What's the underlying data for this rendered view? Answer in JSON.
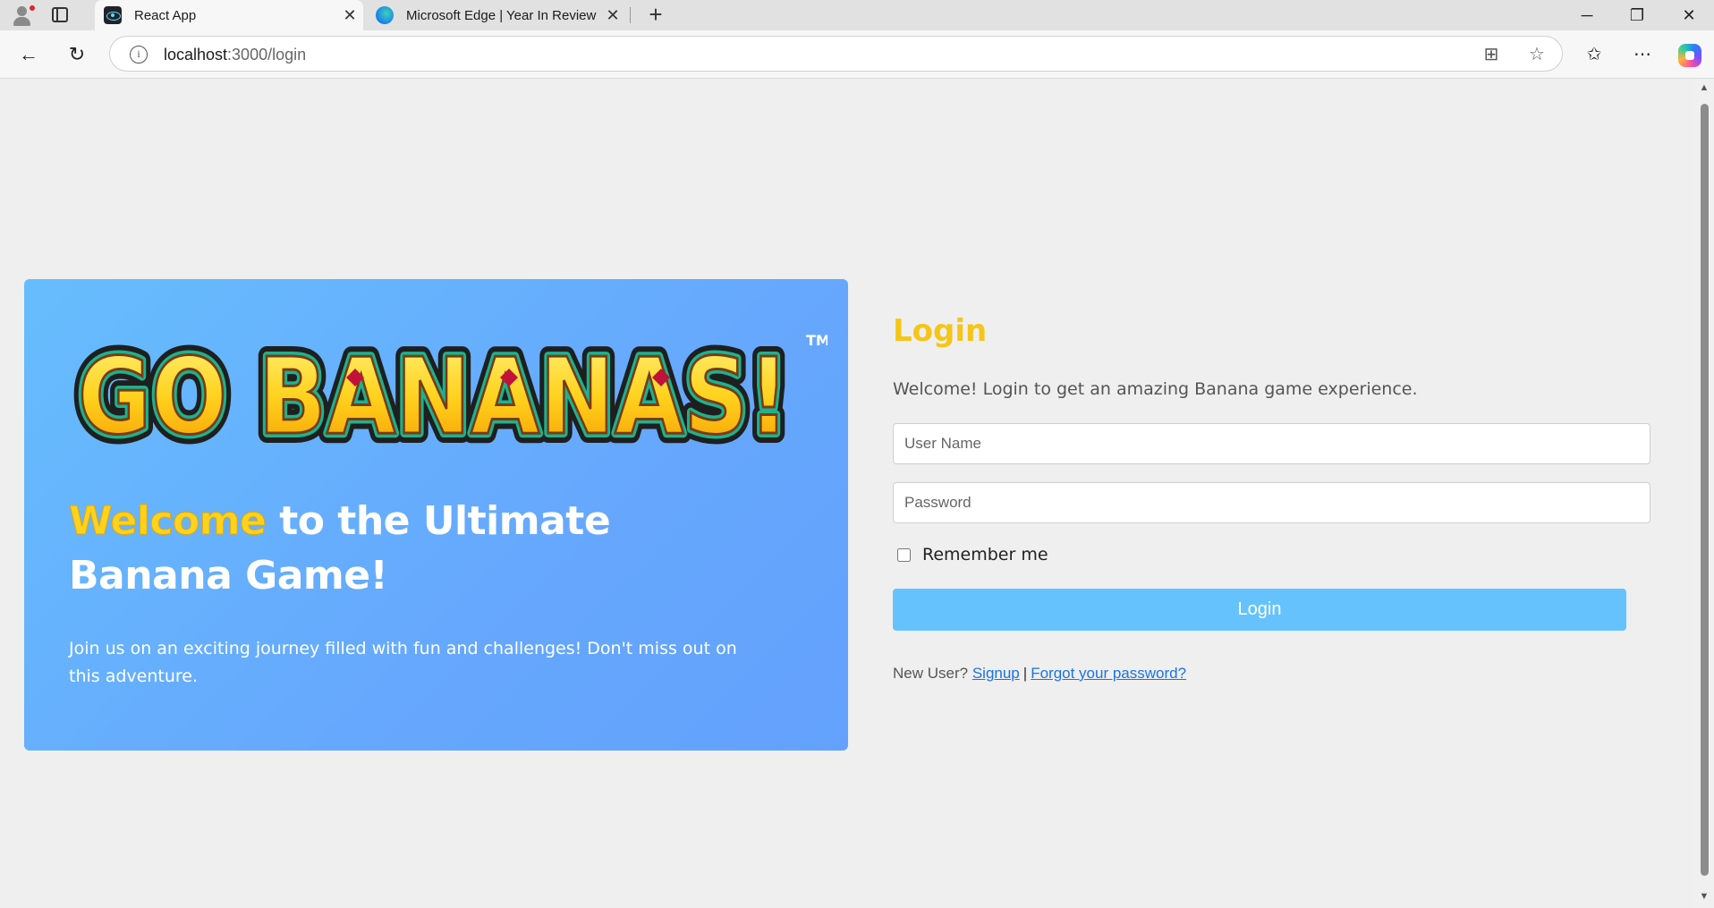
{
  "browser": {
    "tabs": [
      {
        "title": "React App",
        "icon": "react-icon",
        "active": true
      },
      {
        "title": "Microsoft Edge | Year In Review",
        "icon": "edge-icon",
        "active": false
      }
    ],
    "address": {
      "host": "localhost",
      "path": ":3000/login"
    }
  },
  "hero": {
    "logo_text": "GO BANANAS!",
    "logo_tm": "TM",
    "heading_highlight": "Welcome",
    "heading_rest": "to the Ultimate Banana Game!",
    "text": "Join us on an exciting journey filled with fun and challenges! Don't miss out on this adventure."
  },
  "login": {
    "title": "Login",
    "subtitle": "Welcome! Login to get an amazing Banana game experience.",
    "username_placeholder": "User Name",
    "password_placeholder": "Password",
    "remember_label": "Remember me",
    "button_label": "Login",
    "new_user_text": "New User?",
    "signup_link": "Signup",
    "separator": "|",
    "forgot_link": "Forgot your password?"
  },
  "colors": {
    "accent_yellow": "#f5c518",
    "button_blue": "#66c2fc",
    "hero_gradient_start": "#66bdfd",
    "hero_gradient_end": "#63a1fd"
  }
}
